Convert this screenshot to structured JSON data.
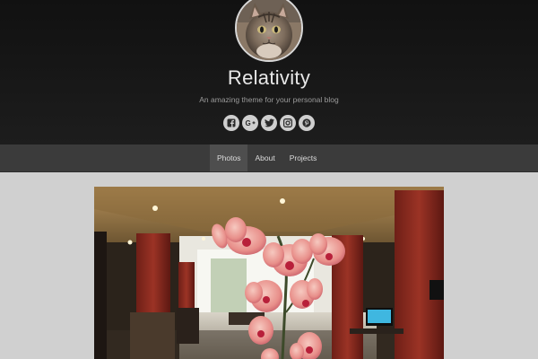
{
  "site": {
    "title": "Relativity",
    "tagline": "An amazing theme for your personal blog"
  },
  "social": [
    {
      "name": "facebook",
      "icon": "facebook-icon"
    },
    {
      "name": "google-plus",
      "icon": "google-plus-icon"
    },
    {
      "name": "twitter",
      "icon": "twitter-icon"
    },
    {
      "name": "instagram",
      "icon": "instagram-icon"
    },
    {
      "name": "pinterest",
      "icon": "pinterest-icon"
    }
  ],
  "nav": {
    "items": [
      {
        "label": "Photos",
        "active": true
      },
      {
        "label": "About",
        "active": false
      },
      {
        "label": "Projects",
        "active": false
      }
    ]
  },
  "colors": {
    "header_bg": "#151515",
    "nav_bg": "#3b3b3b",
    "nav_active_bg": "#4e4e4e",
    "page_bg": "#d0d0d0"
  }
}
